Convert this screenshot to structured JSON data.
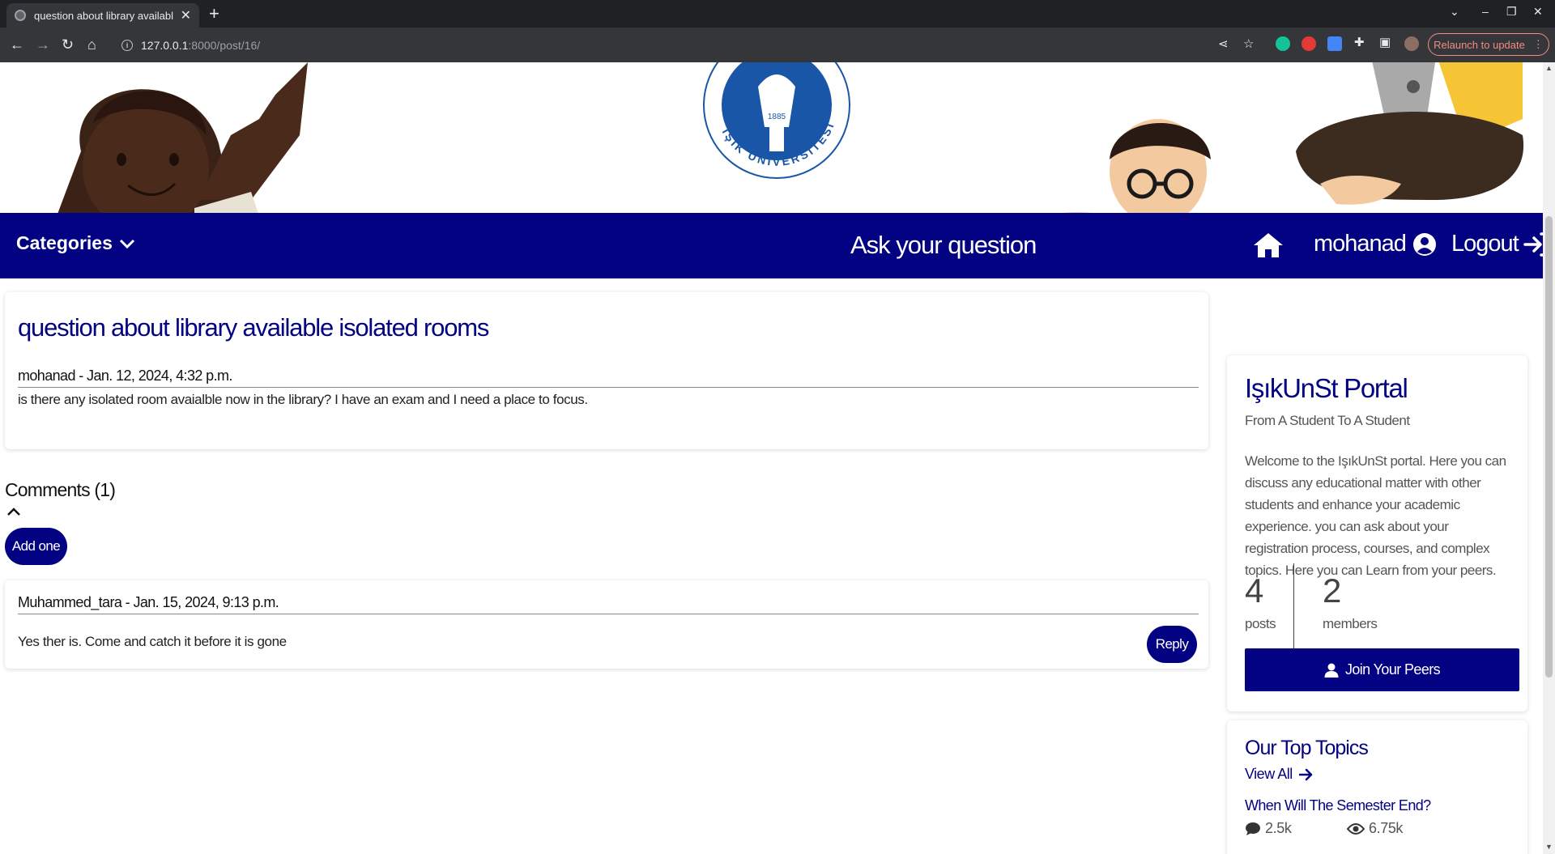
{
  "browser": {
    "tab_title": "question about library availabl",
    "url_host": "127.0.0.1",
    "url_path": ":8000/post/16/",
    "relaunch_label": "Relaunch to update"
  },
  "navbar": {
    "categories_label": "Categories",
    "ask_label": "Ask your question",
    "username": "mohanad",
    "logout_label": "Logout"
  },
  "post": {
    "title": "question about library available isolated rooms",
    "meta": "mohanad - Jan. 12, 2024, 4:32 p.m.",
    "body": "is there any isolated room avaialble now in the library? I have an exam and I need a place to focus."
  },
  "comments": {
    "heading": "Comments (1)",
    "add_label": "Add one",
    "items": [
      {
        "meta": "Muhammed_tara - Jan. 15, 2024, 9:13 p.m.",
        "body": "Yes ther is. Come and catch it before it is gone",
        "reply_label": "Reply"
      }
    ]
  },
  "portal": {
    "title": "IşıkUnSt Portal",
    "subtitle": "From A Student To A Student",
    "description": "Welcome to the IşıkUnSt portal. Here you can discuss any educational matter with other students and enhance your academic experience. you can ask about your registration process, courses, and complex topics. Here you can Learn from your peers.",
    "posts_count": "4",
    "posts_label": "posts",
    "members_count": "2",
    "members_label": "members",
    "join_label": "Join Your Peers"
  },
  "topics": {
    "title": "Our Top Topics",
    "view_all_label": "View All",
    "items": [
      {
        "title": "When Will The Semester End?",
        "comments": "2.5k",
        "views": "6.75k"
      }
    ]
  },
  "logo": {
    "year": "1885",
    "text_bottom": "IŞIK ÜNİVERSİTESİ"
  },
  "colors": {
    "brand_navy": "#020282",
    "chrome_dark": "#202124",
    "relaunch_red": "#f28b82"
  }
}
